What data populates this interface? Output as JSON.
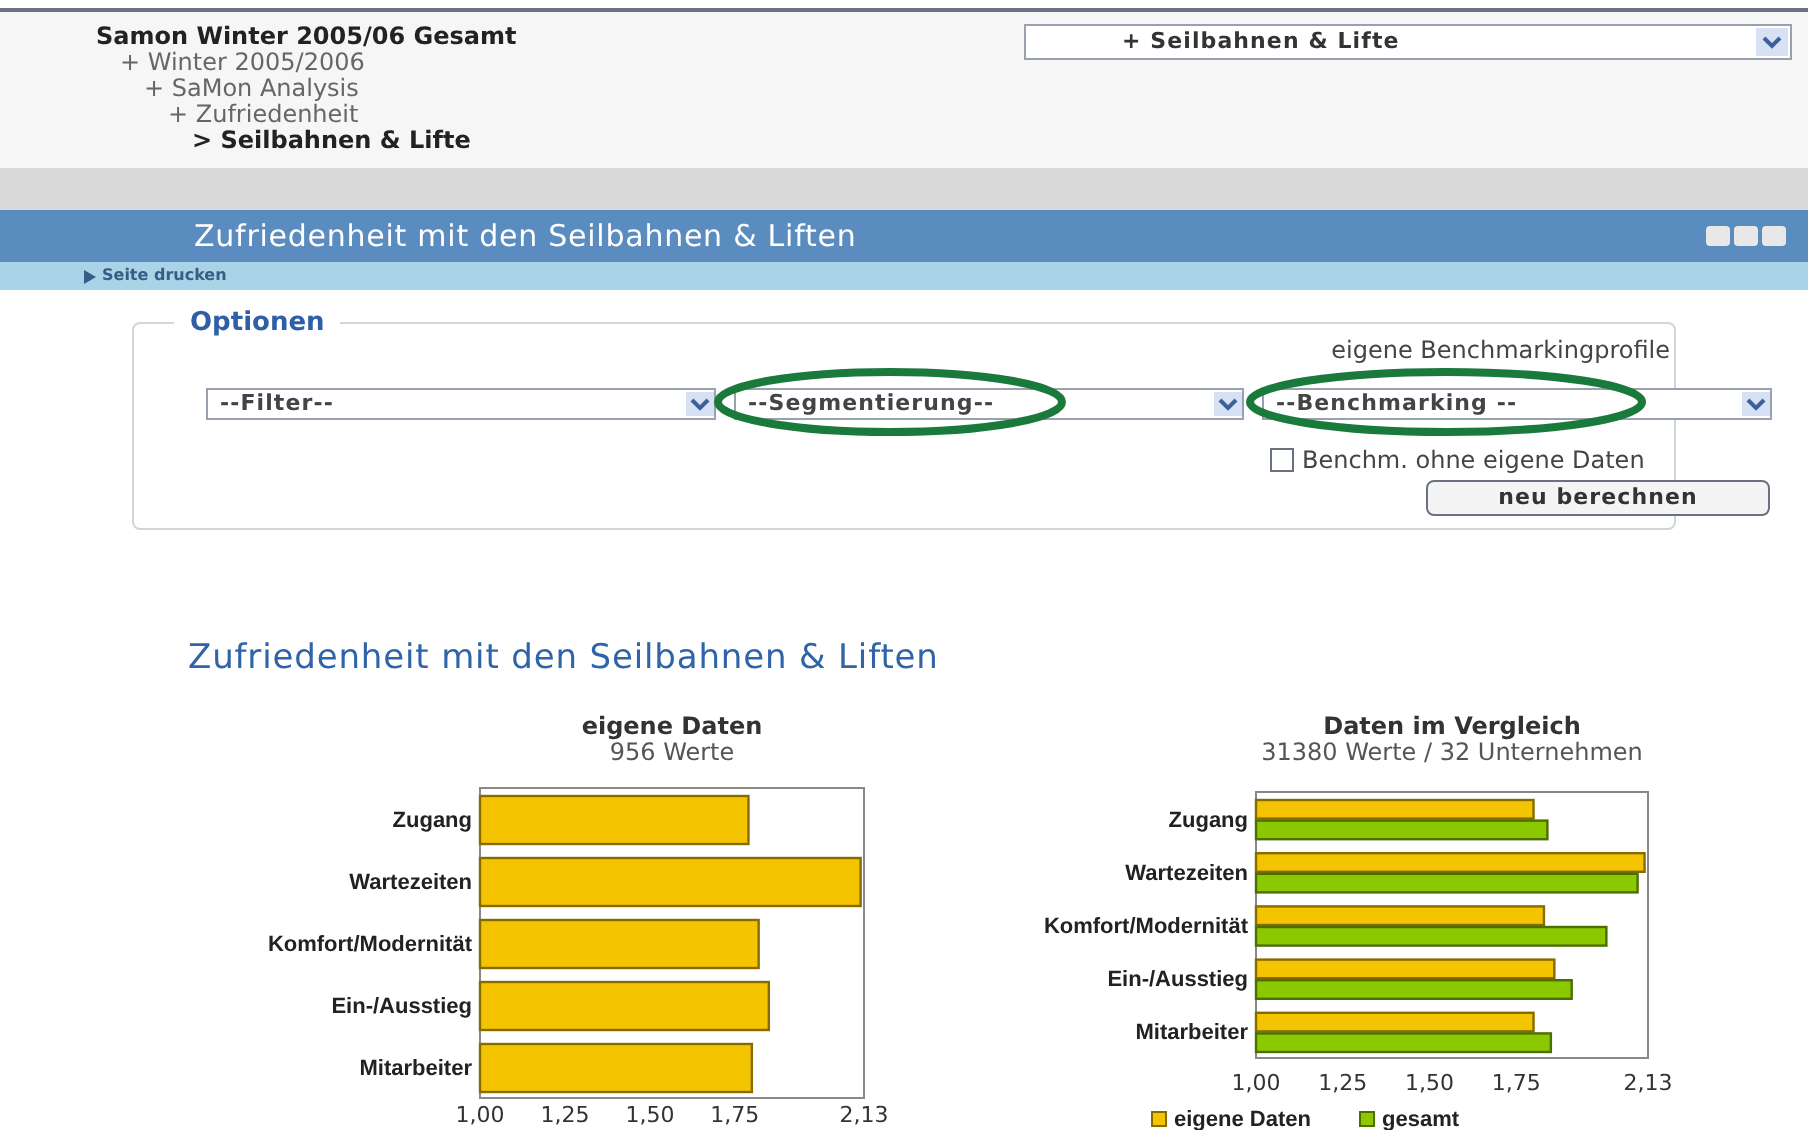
{
  "navigation": {
    "title": "Samon Winter 2005/06 Gesamt",
    "tree": [
      {
        "marker": "+",
        "label": "Winter 2005/2006",
        "selected": false,
        "children": [
          {
            "marker": "+",
            "label": "SaMon Analysis",
            "selected": false,
            "children": [
              {
                "marker": "+",
                "label": "Zufriedenheit",
                "selected": false,
                "children": [
                  {
                    "marker": ">",
                    "label": "Seilbahnen & Lifte",
                    "selected": true
                  }
                ]
              }
            ]
          }
        ]
      }
    ],
    "jump_select": {
      "value": "+ Seilbahnen & Lifte"
    }
  },
  "page_header": {
    "title": "Zufriedenheit mit den Seilbahnen & Liften",
    "print_link": "Seite drucken"
  },
  "options": {
    "legend": "Optionen",
    "profile_label": "eigene Benchmarkingprofile",
    "selects": [
      {
        "value": "--Filter--",
        "circled": false
      },
      {
        "value": "--Segmentierung--",
        "circled": true
      },
      {
        "value": "--Benchmarking --",
        "circled": true
      }
    ],
    "checkbox": {
      "label": "Benchm. ohne eigene Daten",
      "checked": false
    },
    "button": "neu berechnen"
  },
  "section_title": "Zufriedenheit mit den Seilbahnen & Liften",
  "charts": [
    {
      "subtitle": "956 Werte",
      "chart_data": {
        "type": "bar",
        "orientation": "horizontal",
        "title": "eigene Daten",
        "categories": [
          "Zugang",
          "Wartezeiten",
          "Komfort/Modernität",
          "Ein-/Ausstieg",
          "Mitarbeiter"
        ],
        "series": [
          {
            "color": "#f5c400",
            "values": [
              1.79,
              2.12,
              1.82,
              1.85,
              1.8
            ]
          }
        ],
        "xlim": [
          1,
          2.13
        ],
        "xticks": [
          {
            "value": 1,
            "label": "1,00"
          },
          {
            "value": 1.25,
            "label": "1,25"
          },
          {
            "value": 1.5,
            "label": "1,50"
          },
          {
            "value": 1.75,
            "label": "1,75"
          },
          {
            "value": 2.13,
            "label": "2,13"
          }
        ]
      }
    },
    {
      "subtitle": "31380 Werte / 32 Unternehmen",
      "chart_data": {
        "type": "bar",
        "orientation": "horizontal",
        "title": "Daten im Vergleich",
        "categories": [
          "Zugang",
          "Wartezeiten",
          "Komfort/Modernität",
          "Ein-/Ausstieg",
          "Mitarbeiter"
        ],
        "series": [
          {
            "name": "eigene Daten",
            "color": "#f5c400",
            "values": [
              1.8,
              2.12,
              1.83,
              1.86,
              1.8
            ]
          },
          {
            "name": "gesamt",
            "color": "#8cc800",
            "values": [
              1.84,
              2.1,
              2.01,
              1.91,
              1.85
            ]
          }
        ],
        "xlim": [
          1,
          2.13
        ],
        "xticks": [
          {
            "value": 1,
            "label": "1,00"
          },
          {
            "value": 1.25,
            "label": "1,25"
          },
          {
            "value": 1.5,
            "label": "1,50"
          },
          {
            "value": 1.75,
            "label": "1,75"
          },
          {
            "value": 2.13,
            "label": "2,13"
          }
        ],
        "legend": true
      }
    }
  ]
}
